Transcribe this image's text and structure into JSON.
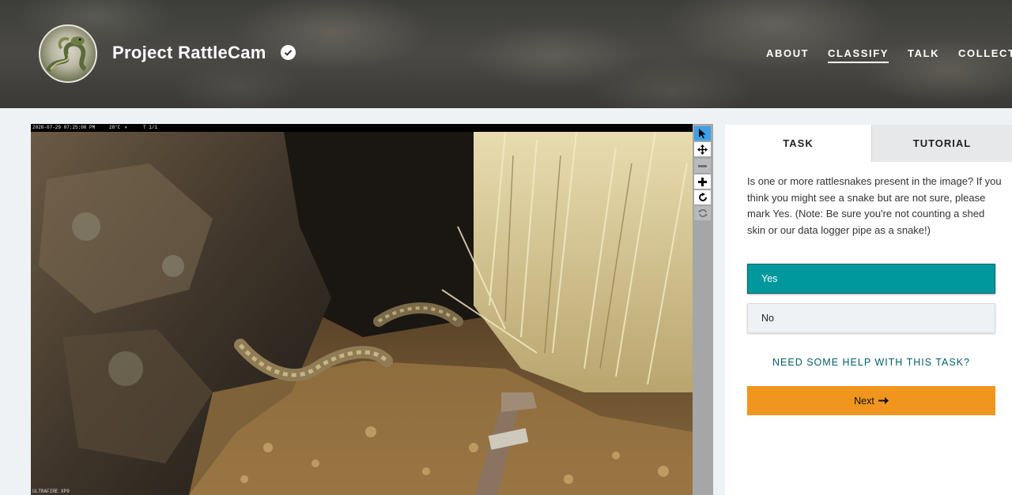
{
  "project": {
    "title": "Project RattleCam",
    "logo_icon": "rattlesnake-logo-icon",
    "verified_icon": "verified-check-icon"
  },
  "nav": {
    "about": "ABOUT",
    "classify": "CLASSIFY",
    "talk": "TALK",
    "collect": "COLLECT"
  },
  "camera": {
    "timestamp": "2020-07-29 07:25:00 PM",
    "temperature": "28°C",
    "moon_icon": "moon-phase-icon",
    "frame": "T 1/1",
    "model": "ULTRAFIRE XP9"
  },
  "toolbar": [
    {
      "name": "annotate-pointer-icon",
      "state": "active"
    },
    {
      "name": "move-icon",
      "state": "enabled"
    },
    {
      "name": "zoom-out-icon",
      "state": "disabled"
    },
    {
      "name": "zoom-in-icon",
      "state": "enabled"
    },
    {
      "name": "rotate-icon",
      "state": "enabled"
    },
    {
      "name": "reset-icon",
      "state": "disabled"
    }
  ],
  "tabs": {
    "task": "TASK",
    "tutorial": "TUTORIAL"
  },
  "task": {
    "question": "Is one or more rattlesnakes present in the image? If you think you might see a snake but are not sure, please mark Yes. (Note: Be sure you're not counting a shed skin or our data logger pipe as a snake!)",
    "answers": [
      "Yes",
      "No"
    ],
    "selected": "Yes",
    "help": "NEED SOME HELP WITH THIS TASK?",
    "next": "Next",
    "next_icon": "arrow-right-icon"
  },
  "colors": {
    "selected_answer": "#00979d",
    "next_button": "#f0961e",
    "help_link": "#005f69",
    "active_tool": "#3da0e6"
  }
}
